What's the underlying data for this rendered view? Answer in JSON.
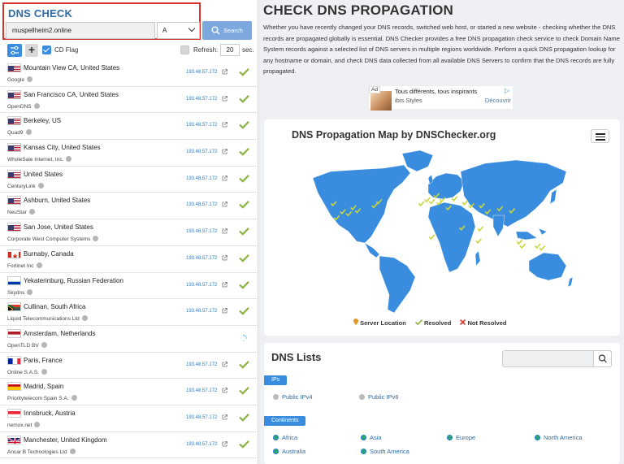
{
  "left": {
    "title": "DNS CHECK",
    "domain_value": "muspellheim2.online",
    "record_type": "A",
    "search_label": "Search",
    "cd_flag_label": "CD Flag",
    "refresh_label": "Refresh:",
    "refresh_value": "20",
    "sec_label": "sec."
  },
  "servers": [
    {
      "location": "Mountain View CA, United States",
      "provider": "Google",
      "ip": "193.48.57.172",
      "status": "resolved",
      "flag": "us"
    },
    {
      "location": "San Francisco CA, United States",
      "provider": "OpenDNS",
      "ip": "193.48.57.172",
      "status": "resolved",
      "flag": "us"
    },
    {
      "location": "Berkeley, US",
      "provider": "Quad9",
      "ip": "193.48.57.172",
      "status": "resolved",
      "flag": "us"
    },
    {
      "location": "Kansas City, United States",
      "provider": "WholeSale Internet, Inc.",
      "ip": "193.48.57.172",
      "status": "resolved",
      "flag": "us"
    },
    {
      "location": "United States",
      "provider": "CenturyLink",
      "ip": "193.48.57.172",
      "status": "resolved",
      "flag": "us"
    },
    {
      "location": "Ashburn, United States",
      "provider": "NeuStar",
      "ip": "193.48.57.172",
      "status": "resolved",
      "flag": "us"
    },
    {
      "location": "San Jose, United States",
      "provider": "Corporate West Computer Systems",
      "ip": "193.48.57.172",
      "status": "resolved",
      "flag": "us"
    },
    {
      "location": "Burnaby, Canada",
      "provider": "Fortinet Inc",
      "ip": "193.48.57.172",
      "status": "resolved",
      "flag": "ca"
    },
    {
      "location": "Yekaterinburg, Russian Federation",
      "provider": "Skydns",
      "ip": "193.48.57.172",
      "status": "resolved",
      "flag": "ru"
    },
    {
      "location": "Cullinan, South Africa",
      "provider": "Liquid Telecommunications Ltd",
      "ip": "193.48.57.172",
      "status": "resolved",
      "flag": "za"
    },
    {
      "location": "Amsterdam, Netherlands",
      "provider": "OpenTLD BV",
      "ip": "",
      "status": "loading",
      "flag": "nl"
    },
    {
      "location": "Paris, France",
      "provider": "Online S.A.S.",
      "ip": "193.48.57.172",
      "status": "resolved",
      "flag": "fr"
    },
    {
      "location": "Madrid, Spain",
      "provider": "Prioritytelecom Spain S.A.",
      "ip": "193.48.57.172",
      "status": "resolved",
      "flag": "es"
    },
    {
      "location": "Innsbruck, Austria",
      "provider": "nemox.net",
      "ip": "193.48.57.172",
      "status": "resolved",
      "flag": "at"
    },
    {
      "location": "Manchester, United Kingdom",
      "provider": "Ancar B Technologies Ltd",
      "ip": "193.48.57.172",
      "status": "resolved",
      "flag": "gb"
    }
  ],
  "main": {
    "title": "CHECK DNS PROPAGATION",
    "intro": "Whether you have recently changed your DNS records, switched web host, or started a new website - checking whether the DNS records are propagated globally is essential. DNS Checker provides a free DNS propagation check service to check Domain Name System records against a selected list of DNS servers in multiple regions worldwide. Perform a quick DNS propagation lookup for any hostname or domain, and check DNS data collected from all available DNS Servers to confirm that the DNS records are fully propagated."
  },
  "ad": {
    "badge": "Ad",
    "line1": "Tous différents, tous inspirants",
    "line2": "ibis Styles",
    "cta": "Découvrir"
  },
  "map": {
    "title": "DNS Propagation Map by DNSChecker.org",
    "legend_location": "Server Location",
    "legend_resolved": "Resolved",
    "legend_not_resolved": "Not Resolved"
  },
  "lists": {
    "title": "DNS Lists",
    "ips_tag": "IPs",
    "ipv4": "Public IPv4",
    "ipv6": "Public IPv6",
    "continents_tag": "Continents",
    "continents": [
      "Africa",
      "Asia",
      "Europe",
      "North America",
      "Australia",
      "South America"
    ]
  },
  "colors": {
    "accent": "#3a8dde",
    "title_blue": "#2e6aa6",
    "map_land": "#3a8dde",
    "resolved_green": "#8ab63f",
    "highlight_red": "#d9342b"
  }
}
